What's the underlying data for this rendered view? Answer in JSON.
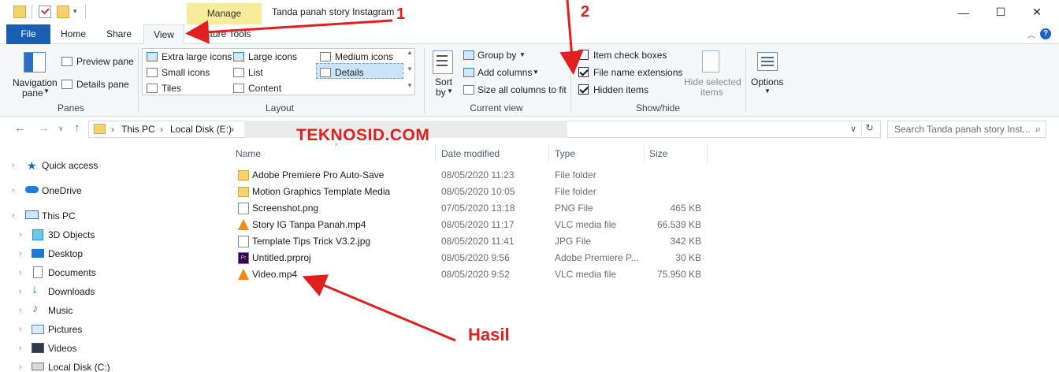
{
  "window": {
    "title": "Tanda panah story Instagram",
    "context_tab": "Manage",
    "controls": {
      "minimize": "—",
      "maximize": "☐",
      "close": "✕"
    }
  },
  "tabs": {
    "file": "File",
    "home": "Home",
    "share": "Share",
    "view": "View",
    "picture_tools": "Picture Tools"
  },
  "ribbon": {
    "panes": {
      "navigation_pane": "Navigation",
      "navigation_pane_2": "pane",
      "preview_pane": "Preview pane",
      "details_pane": "Details pane",
      "label": "Panes"
    },
    "layout": {
      "extra_large": "Extra large icons",
      "large": "Large icons",
      "medium": "Medium icons",
      "small": "Small icons",
      "list": "List",
      "details": "Details",
      "tiles": "Tiles",
      "content": "Content",
      "label": "Layout"
    },
    "current_view": {
      "sort_by": "Sort",
      "sort_by_2": "by",
      "group_by": "Group by",
      "add_columns": "Add columns",
      "size_all": "Size all columns to fit",
      "label": "Current view"
    },
    "show_hide": {
      "item_check_boxes": "Item check boxes",
      "file_name_extensions": "File name extensions",
      "hidden_items": "Hidden items",
      "hide_selected": "Hide selected",
      "hide_selected_2": "items",
      "label": "Show/hide",
      "item_check_boxes_checked": false,
      "file_name_extensions_checked": true,
      "hidden_items_checked": true
    },
    "options": "Options"
  },
  "address": {
    "crumbs": [
      "This PC",
      "Local Disk (E:)"
    ],
    "separator": "›",
    "search_placeholder": "Search Tanda panah story Inst..."
  },
  "nav": {
    "quick_access": "Quick access",
    "onedrive": "OneDrive",
    "this_pc": "This PC",
    "objects3d": "3D Objects",
    "desktop": "Desktop",
    "documents": "Documents",
    "downloads": "Downloads",
    "music": "Music",
    "pictures": "Pictures",
    "videos": "Videos",
    "local_c": "Local Disk (C:)"
  },
  "columns": {
    "name": "Name",
    "date": "Date modified",
    "type": "Type",
    "size": "Size"
  },
  "files": [
    {
      "name": "Adobe Premiere Pro Auto-Save",
      "date": "08/05/2020 11:23",
      "type": "File folder",
      "size": "",
      "icon": "folder-icon"
    },
    {
      "name": "Motion Graphics Template Media",
      "date": "08/05/2020 10:05",
      "type": "File folder",
      "size": "",
      "icon": "folder-icon"
    },
    {
      "name": "Screenshot.png",
      "date": "07/05/2020 13:18",
      "type": "PNG File",
      "size": "465 KB",
      "icon": "image-file-icon"
    },
    {
      "name": "Story IG Tanpa Panah.mp4",
      "date": "08/05/2020 11:17",
      "type": "VLC media file",
      "size": "66.539 KB",
      "icon": "vlc-icon"
    },
    {
      "name": "Template Tips Trick V3.2.jpg",
      "date": "08/05/2020 11:41",
      "type": "JPG File",
      "size": "342 KB",
      "icon": "image-file-icon"
    },
    {
      "name": "Untitled.prproj",
      "date": "08/05/2020 9:56",
      "type": "Adobe Premiere P...",
      "size": "30 KB",
      "icon": "premiere-icon"
    },
    {
      "name": "Video.mp4",
      "date": "08/05/2020 9:52",
      "type": "VLC media file",
      "size": "75.950 KB",
      "icon": "vlc-icon"
    }
  ],
  "annotations": {
    "num1": "1",
    "num2": "2",
    "watermark": "TEKNOSID.COM",
    "result": "Hasil",
    "color": "#e01f1f"
  }
}
